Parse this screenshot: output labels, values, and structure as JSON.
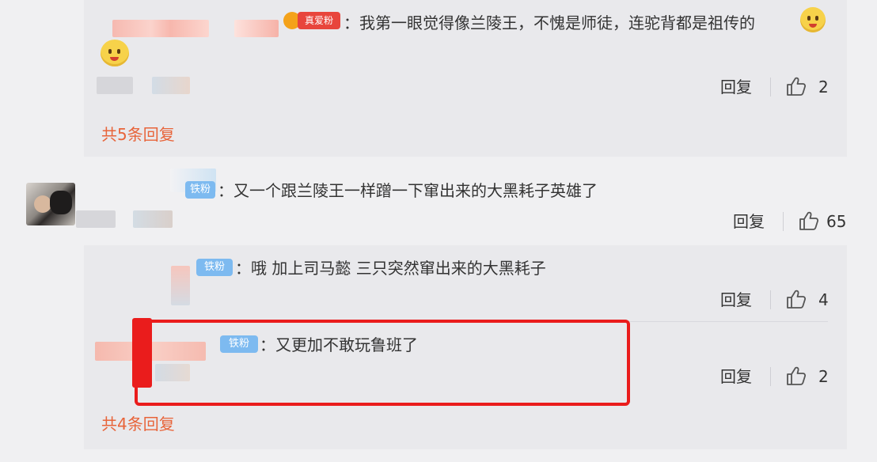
{
  "thread": {
    "reply1": {
      "badge": "真爱粉",
      "text": "：我第一眼觉得像兰陵王，不愧是师徒，连驼背都是祖传的",
      "reply_label": "回复",
      "likes": "2"
    },
    "more1": "共5条回复",
    "comment": {
      "badge": "铁粉",
      "text": "：又一个跟兰陵王一样蹭一下窜出来的大黑耗子英雄了",
      "reply_label": "回复",
      "likes": "65"
    },
    "reply2": {
      "badge": "铁粉",
      "text": "：哦 加上司马懿 三只突然窜出来的大黑耗子",
      "reply_label": "回复",
      "likes": "4"
    },
    "reply3": {
      "badge": "铁粉",
      "text": "：又更加不敢玩鲁班了",
      "reply_label": "回复",
      "likes": "2"
    },
    "more2": "共4条回复"
  },
  "colors": {
    "accent_orange": "#e8643a",
    "highlight_red": "#ea1c1c",
    "badge_blue": "#7dbaf0",
    "badge_red": "#e8453c"
  }
}
